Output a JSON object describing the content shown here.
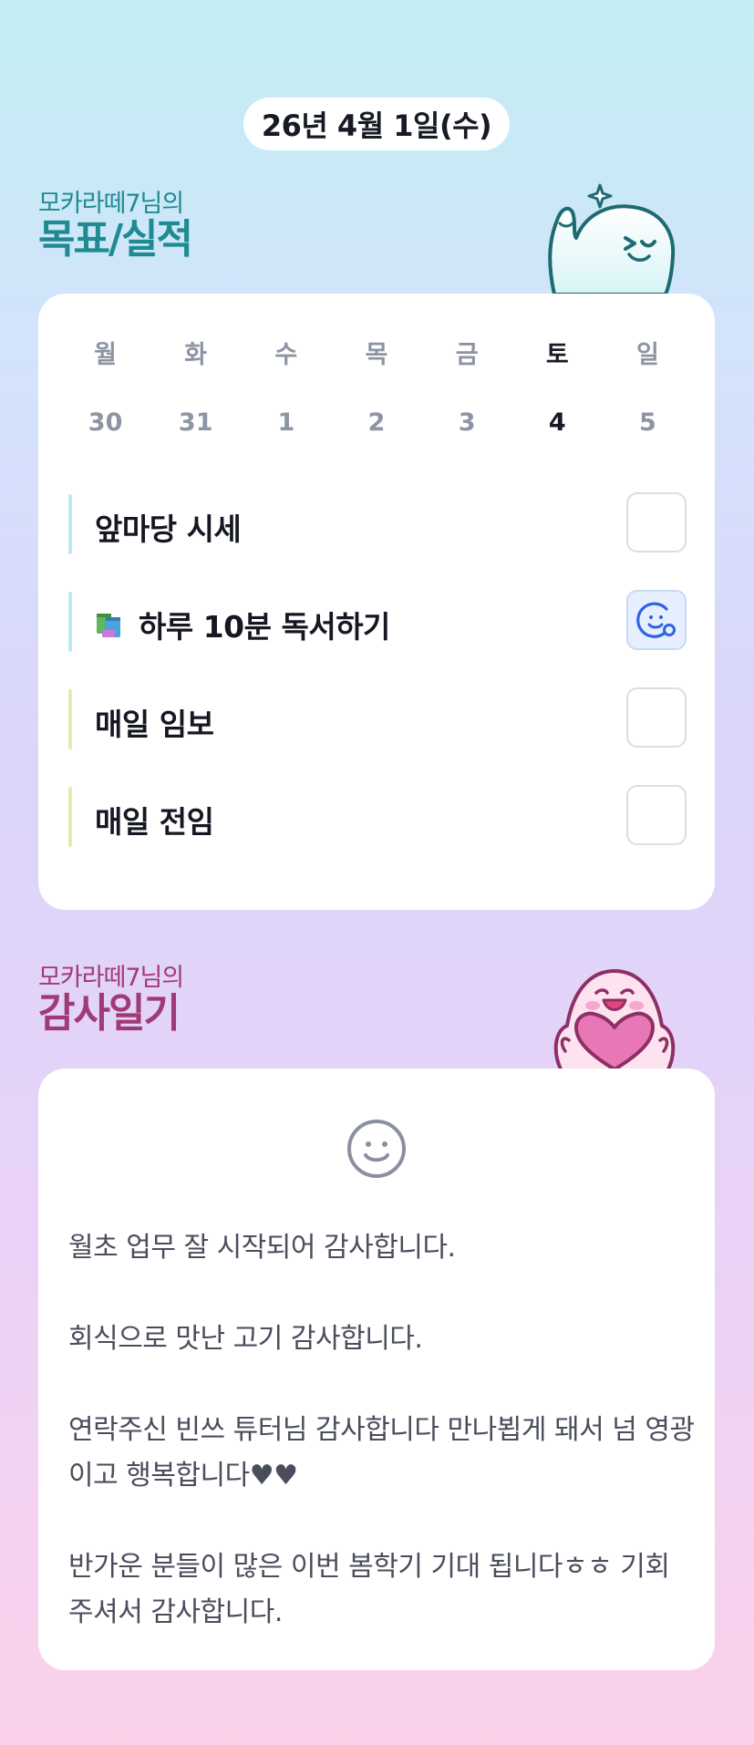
{
  "header": {
    "date": "26년 4월 1일(수)"
  },
  "goals_section": {
    "owner": "모카라떼7님의",
    "title": "목표/실적",
    "week": [
      {
        "day": "월",
        "num": "30",
        "active": false
      },
      {
        "day": "화",
        "num": "31",
        "active": false
      },
      {
        "day": "수",
        "num": "1",
        "active": false
      },
      {
        "day": "목",
        "num": "2",
        "active": false
      },
      {
        "day": "금",
        "num": "3",
        "active": false
      },
      {
        "day": "토",
        "num": "4",
        "active": true
      },
      {
        "day": "일",
        "num": "5",
        "active": false
      }
    ],
    "items": [
      {
        "label": "앞마당 시세",
        "done": false,
        "bar_color": "#bfe9f0"
      },
      {
        "label": "하루 10분 독서하기",
        "icon": "books-icon",
        "done": true,
        "bar_color": "#bfe9f0"
      },
      {
        "label": "매일 임보",
        "done": false,
        "bar_color": "#dcefb2"
      },
      {
        "label": "매일 전임",
        "done": false,
        "bar_color": "#dcefb2"
      }
    ]
  },
  "thanks_section": {
    "owner": "모카라떼7님의",
    "title": "감사일기",
    "mood_icon": "smiley-icon",
    "entries": [
      "월초 업무 잘 시작되어 감사합니다.",
      "회식으로 맛난 고기 감사합니다.",
      "연락주신 빈쓰 튜터님 감사합니다 만나뵙게 돼서 넘 영광이고 행복합니다♥♥",
      "반가운 분들이 많은 이번 봄학기 기대 됩니다ㅎㅎ 기회 주셔서 감사합니다."
    ]
  },
  "colors": {
    "goals_accent": "#1f8a92",
    "thanks_accent": "#a13a74",
    "done_check_accent": "#2f62e6",
    "inactive_text": "#8d94a4"
  }
}
